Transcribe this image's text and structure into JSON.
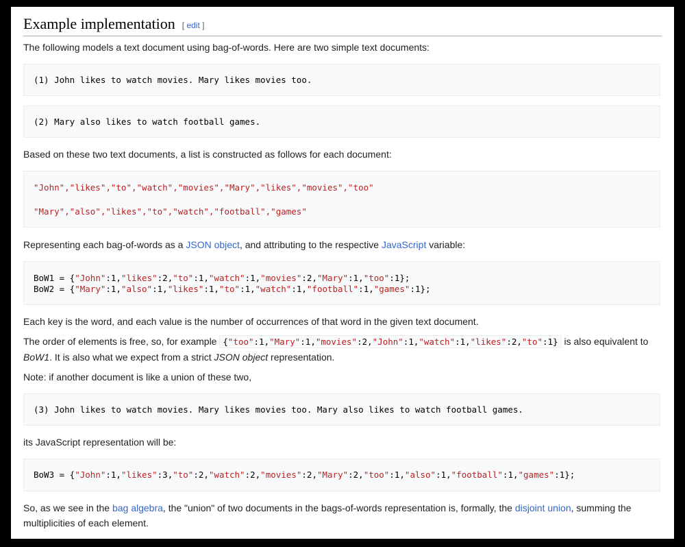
{
  "heading": {
    "title": "Example implementation",
    "edit_open": "[ ",
    "edit_label": "edit",
    "edit_close": " ]"
  },
  "para1": "The following models a text document using bag-of-words. Here are two simple text documents:",
  "doc1": "(1) John likes to watch movies. Mary likes movies too.",
  "doc2": "(2) Mary also likes to watch football games.",
  "para2": "Based on these two text documents, a list is constructed as follows for each document:",
  "list1": "\"John\",\"likes\",\"to\",\"watch\",\"movies\",\"Mary\",\"likes\",\"movies\",\"too\"",
  "list2": "\"Mary\",\"also\",\"likes\",\"to\",\"watch\",\"football\",\"games\"",
  "para3": {
    "t1": "Representing each bag-of-words as a ",
    "link1": "JSON object",
    "t2": ", and attributing to the respective ",
    "link2": "JavaScript",
    "t3": " variable:"
  },
  "bow1": "BoW1 = {\"John\":1,\"likes\":2,\"to\":1,\"watch\":1,\"movies\":2,\"Mary\":1,\"too\":1};",
  "bow2": "BoW2 = {\"Mary\":1,\"also\":1,\"likes\":1,\"to\":1,\"watch\":1,\"football\":1,\"games\":1};",
  "para4": "Each key is the word, and each value is the number of occurrences of that word in the given text document.",
  "para5": {
    "t1": "The order of elements is free, so, for example ",
    "code": "{\"too\":1,\"Mary\":1,\"movies\":2,\"John\":1,\"watch\":1,\"likes\":2,\"to\":1}",
    "t2": " is also equivalent to",
    "i1": "BoW1",
    "t3": ". It is also what we expect from a strict ",
    "i2": "JSON object",
    "t4": " representation."
  },
  "para6": "Note: if another document is like a union of these two,",
  "doc3": "(3) John likes to watch movies. Mary likes movies too. Mary also likes to watch football games.",
  "para7": "its JavaScript representation will be:",
  "bow3": "BoW3 = {\"John\":1,\"likes\":3,\"to\":2,\"watch\":2,\"movies\":2,\"Mary\":2,\"too\":1,\"also\":1,\"football\":1,\"games\":1};",
  "para8": {
    "t1": "So, as we see in the ",
    "link1": "bag algebra",
    "t2": ", the \"union\" of two documents in the bags-of-words representation is, formally, the ",
    "link2": "disjoint union",
    "t3": ", summing the",
    "t4": "multiplicities of each element."
  },
  "colors": {
    "link": "#3366cc",
    "string": "#ba2121",
    "pre_bg": "#f8f9fa",
    "border": "#eaecf0"
  }
}
